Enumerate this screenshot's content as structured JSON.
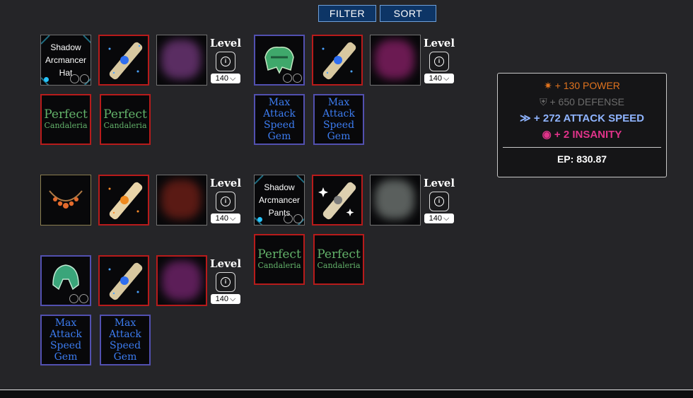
{
  "toolbar": {
    "filter_label": "FILTER",
    "sort_label": "SORT"
  },
  "level": {
    "label": "Level",
    "value": "140",
    "info_glyph": "i"
  },
  "items": {
    "hat_name": "Shadow Arcmancer Hat",
    "pants_name": "Shadow Arcmancer Pants",
    "perfect_line1": "Perfect",
    "perfect_line2": "Candaleria",
    "gem_name": "Max Attack Speed Gem"
  },
  "stats": {
    "power": "+ 130 POWER",
    "defense": "+ 650 DEFENSE",
    "attack_speed": "+ 272 ATTACK SPEED",
    "insanity": "+ 2 INSANITY",
    "ep": "EP: 830.87"
  },
  "colors": {
    "power": "#e0731e",
    "defense": "#6c6c6c",
    "attack_speed": "#8fb4ff",
    "insanity": "#e0338a",
    "slot_red": "#b81b1b",
    "slot_blue": "#5250b0"
  }
}
